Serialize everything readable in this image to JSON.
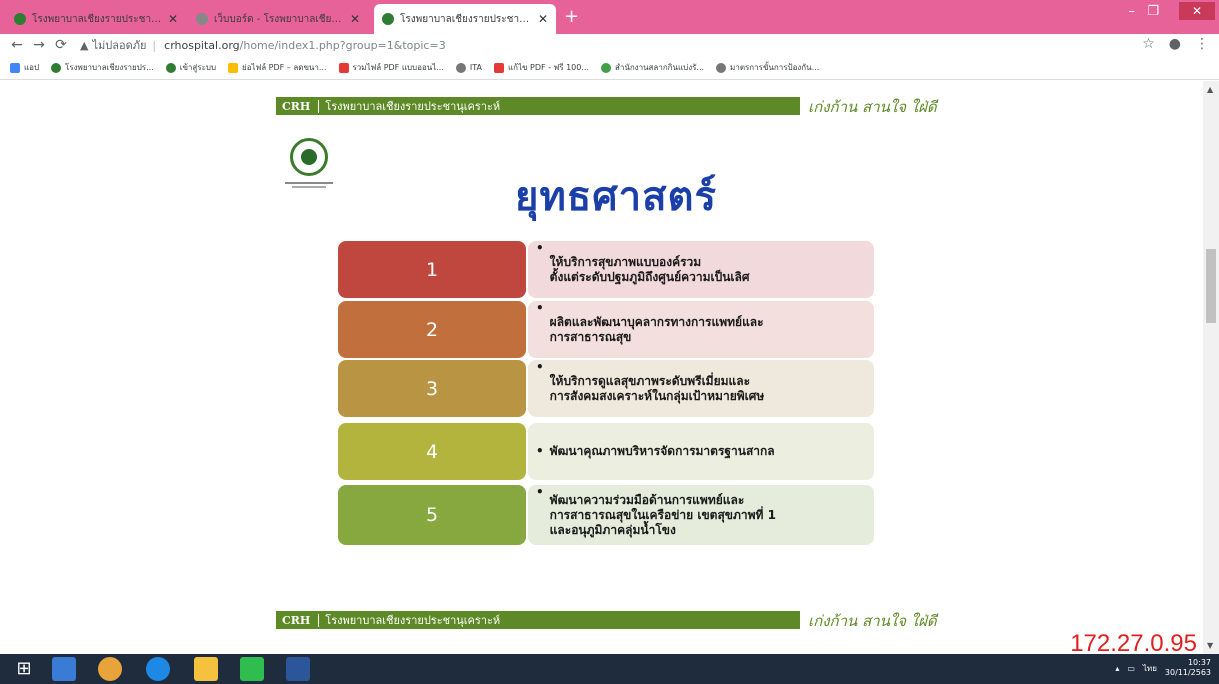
{
  "browser": {
    "tabs": [
      {
        "title": "โรงพยาบาลเชียงรายประชานุเคราะห์ - ...",
        "active": false,
        "fav_color": "#2e7d32"
      },
      {
        "title": "เว็บบอร์ด - โรงพยาบาลเชียงรายประชา...",
        "active": false,
        "fav_color": "#888888"
      },
      {
        "title": "โรงพยาบาลเชียงรายประชานุเคราะห์",
        "active": true,
        "fav_color": "#2e7d32"
      }
    ],
    "new_tab": "+",
    "security_label": "ไม่ปลอดภัย",
    "url_host": "crhospital.org",
    "url_path": "/home/index1.php?group=1&topic=3",
    "bookmarks": [
      {
        "label": "แอป",
        "color": "#4285f4"
      },
      {
        "label": "โรงพยาบาลเชียงรายปร...",
        "color": "#2e7d32"
      },
      {
        "label": "เข้าสู่ระบบ",
        "color": "#2e7d32"
      },
      {
        "label": "ย่อไฟล์ PDF – ลดขนา...",
        "color": "#fbbc05"
      },
      {
        "label": "รวมไฟล์ PDF แบบออนไ...",
        "color": "#e53935"
      },
      {
        "label": "ITA",
        "color": "#777777"
      },
      {
        "label": "แก้ไข PDF - ฟรี 100...",
        "color": "#e53935"
      },
      {
        "label": "สำนักงานสลากกินแบ่งรั...",
        "color": "#43a047"
      },
      {
        "label": "มาตรการขั้นการป้องกัน...",
        "color": "#777777"
      }
    ]
  },
  "slide": {
    "header_crh": "CRH",
    "header_name": "โรงพยาบาลเชียงรายประชานุเคราะห์",
    "slogan": "เก่งก้าน สานใจ ใฝ่ดี",
    "title": "ยุทธศาสตร์",
    "items": [
      {
        "num": "1",
        "text": "ให้บริการสุขภาพแบบองค์รวม\nตั้งแต่ระดับปฐมภูมิถึงศูนย์ความเป็นเลิศ",
        "num_color": "#c0473d",
        "desc_color": "#f2d9dc"
      },
      {
        "num": "2",
        "text": "ผลิตและพัฒนาบุคลากรทางการแพทย์และ\nการสาธารณสุข",
        "num_color": "#c26f3e",
        "desc_color": "#f3e0de"
      },
      {
        "num": "3",
        "text": "ให้บริการดูแลสุขภาพระดับพรีเมี่ยมและ\nการสังคมสงเคราะห์ในกลุ่มเป้าหมายพิเศษ",
        "num_color": "#b89443",
        "desc_color": "#efe8dc"
      },
      {
        "num": "4",
        "text": "พัฒนาคุณภาพบริหารจัดการมาตรฐานสากล",
        "num_color": "#b3b43d",
        "desc_color": "#ecefe0"
      },
      {
        "num": "5",
        "text": "พัฒนาความร่วมมือด้านการแพทย์และ\nการสาธารณสุขในเครือข่าย เขตสุขภาพที่ 1\nและอนุภูมิภาคลุ่มน้ำโขง",
        "num_color": "#86a83e",
        "desc_color": "#e5ecdc"
      }
    ]
  },
  "taskbar": {
    "lang": "ไทย",
    "time": "10:37",
    "date": "30/11/2563"
  },
  "overlay_ip": "172.27.0.95"
}
